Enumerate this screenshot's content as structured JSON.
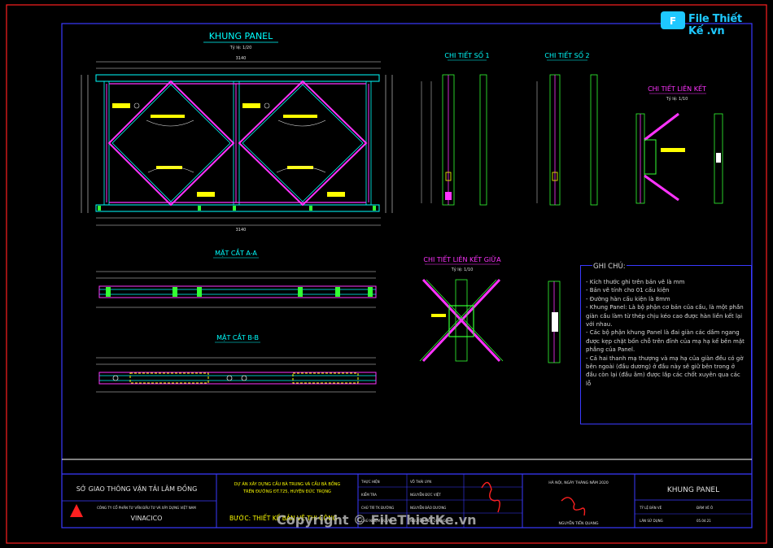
{
  "watermark": {
    "logo_text": "File Thiết Kế .vn",
    "copyright": "Copyright © FileThietKe.vn"
  },
  "drawing": {
    "main_title": "KHUNG PANEL",
    "main_scale": "Tỷ lệ: 1/20",
    "detail1": "CHI TIẾT SỐ 1",
    "detail2": "CHI TIẾT SỐ 2",
    "connection": "CHI TIẾT LIÊN KẾT",
    "connection_scale": "Tỷ lệ: 1/10",
    "mid_connection": "CHI TIẾT LIÊN KẾT GIỮA",
    "mid_connection_scale": "Tỷ lệ: 1/10",
    "section_aa": "MẶT CẮT A-A",
    "section_bb": "MẶT CẮT B-B",
    "overall_dim": "3140",
    "colors": {
      "frame": "#ff2020",
      "border": "#2b2bff",
      "cyan": "#00ffff",
      "magenta": "#ff33ff",
      "yellow": "#ffff00",
      "green": "#33ff33"
    }
  },
  "notes": {
    "heading": "GHI CHÚ:",
    "items": [
      "- Kích thước ghi trên bản vẽ là mm",
      "- Bản vẽ tính cho 01 cấu kiện",
      "- Đường hàn cấu kiện là 8mm",
      "- Khung Panel: Là bộ phận cơ bản của cầu, là một phần giàn cầu làm từ thép chịu kéo cao được hàn liền kết lại với nhau.",
      "- Các bộ phận khung Panel là đai giàn các dầm ngang được kẹp chặt bốn chỗ trên đỉnh của mạ hạ kế bên mặt phẳng của Panel.",
      "- Cả hai thanh mạ thượng và mạ hạ của giàn đều có gờ bên ngoài (đầu dương) ở đầu này sẽ giữ bên trong ở đầu còn lại (đầu âm) được lắp các chốt xuyên qua các lỗ"
    ]
  },
  "title_block": {
    "agency": "SỞ GIAO THÔNG VẬN TẢI LÂM ĐỒNG",
    "company": "CÔNG TY CỔ PHẦN TƯ VẤN ĐẦU TƯ VÀ XÂY DỰNG VIỆT NAM",
    "company_short": "VINACICO",
    "project_line1": "DỰ ÁN XÂY DỰNG CẦU BÀ TRUNG VÀ CẦU BÀ BỒNG",
    "project_line2": "TRÊN ĐƯỜNG ĐT.725, HUYỆN ĐỨC TRỌNG",
    "stage": "BƯỚC: THIẾT KẾ BẢN VẼ THI CÔNG",
    "roles": [
      "THỰC HIỆN",
      "KIỂM TRA",
      "CHỦ TRÌ TK ĐƯỜNG",
      "CHỦ NHIỆM DỰ ÁN"
    ],
    "names": [
      "VÕ THÁI UYN",
      "NGUYỄN ĐỨC VIỆT",
      "NGUYỄN BẢO DƯƠNG",
      "NGUYỄN TIẾN QUANG"
    ],
    "date_line": "HÀ NỘI, NGÀY   THÁNG    NĂM 2020",
    "signer": "NGUYỄN TIẾN QUANG",
    "sheet_title": "KHUNG PANEL",
    "f1_label": "TỶ LỆ BẢN VẼ",
    "f1_value": "ĐÀM VẼ Ô",
    "f2_label": "LÁN SỬ DỤNG",
    "f2_value": "05.04.21"
  }
}
